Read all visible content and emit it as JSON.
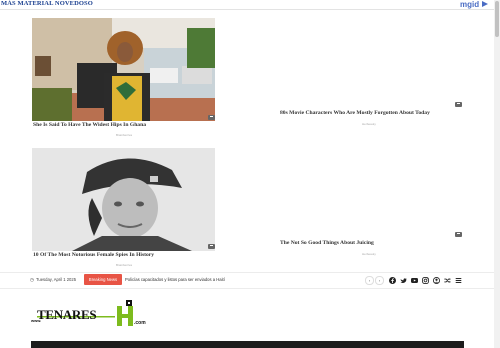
{
  "ad_widget": {
    "title": "MÁS MATERIAL NOVEDOSO",
    "brand": "mgid",
    "cards": [
      {
        "title": "She Is Said To Have The Widest Hips In Ghana",
        "source": "Brainberries"
      },
      {
        "title": "80s Movie Characters Who Are Mostly Forgotten About Today",
        "source": "Herbeauty"
      },
      {
        "title": "10 Of The Most Notorious Female Spies In History",
        "source": "Brainberries"
      },
      {
        "title": "The Not So Good Things About Juicing",
        "source": "Herbeauty"
      }
    ]
  },
  "topbar": {
    "date": "Tuesday, April 1 2025",
    "breaking_label": "Breaking News",
    "ticker_text": "Policías capacitados y listos para ser enviados a Haití",
    "prev": "‹",
    "next": "›",
    "social_icons": [
      "facebook-icon",
      "twitter-icon",
      "youtube-icon",
      "instagram-icon",
      "user-icon",
      "random-icon",
      "menu-icon"
    ]
  },
  "logo": {
    "prefix": "www.",
    "text": "TENARES",
    "suffix": ".com"
  },
  "colors": {
    "ad_title": "#1a3f8f",
    "mgid": "#4a6cc4",
    "breaking": "#e85445",
    "logo_green": "#7dbb1e",
    "nav_dark": "#1c1c1c"
  }
}
